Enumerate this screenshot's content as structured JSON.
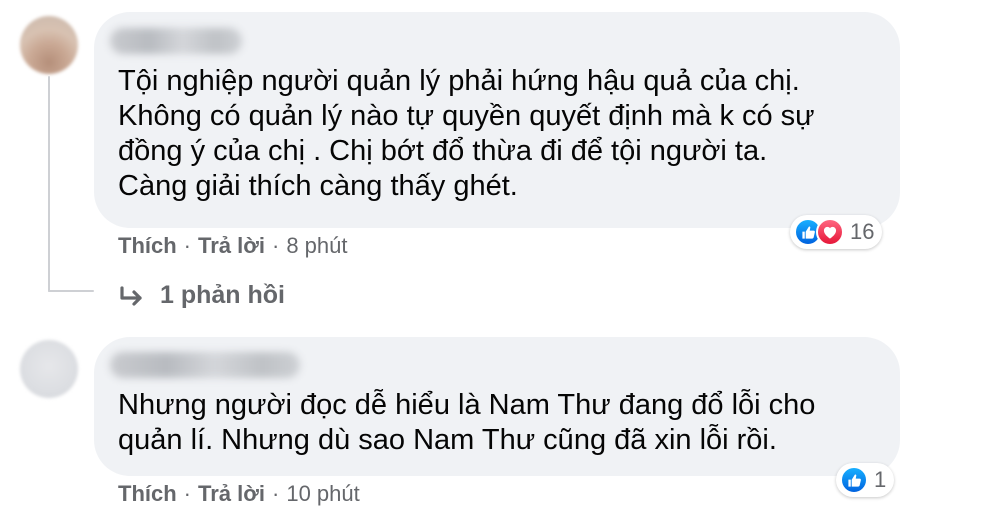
{
  "comments": [
    {
      "text_lines": [
        "Tội nghiệp người quản lý phải hứng hậu quả của chị.",
        "Không có quản lý nào tự quyền quyết định mà k có sự",
        "đồng ý của chị . Chị bớt đổ thừa đi để tội người ta.",
        "Càng giải thích càng thấy ghét."
      ],
      "like_label": "Thích",
      "reply_label": "Trả lời",
      "time": "8 phút",
      "reaction_count": "16",
      "reaction_icons": [
        "like-icon",
        "love-icon"
      ],
      "replies_label": "1 phản hồi"
    },
    {
      "text_lines": [
        "Nhưng người đọc dễ hiểu là Nam Thư đang đổ lỗi cho",
        "quản lí. Nhưng dù sao Nam Thư cũng đã xin lỗi rồi."
      ],
      "like_label": "Thích",
      "reply_label": "Trả lời",
      "time": "10 phút",
      "reaction_count": "1",
      "reaction_icons": [
        "like-icon"
      ]
    }
  ],
  "colors": {
    "bubble_bg": "#f0f2f5",
    "meta_text": "#65676b",
    "like_blue": "#0571ed",
    "love_red": "#f33e58"
  }
}
